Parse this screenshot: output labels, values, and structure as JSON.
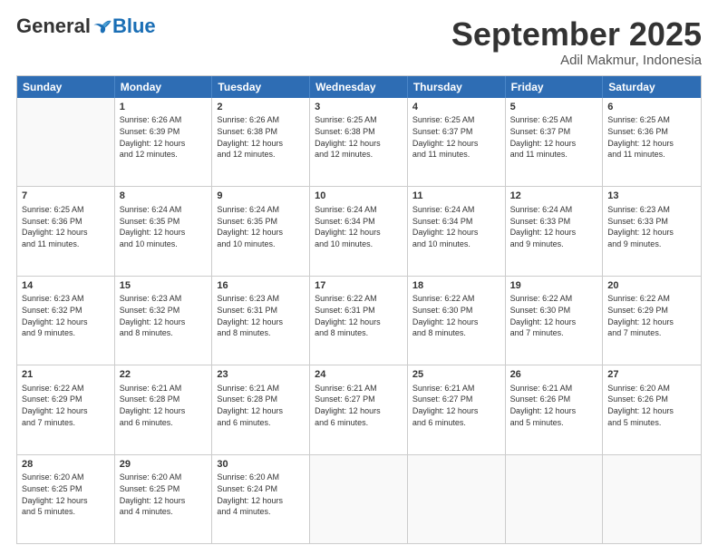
{
  "logo": {
    "general": "General",
    "blue": "Blue"
  },
  "title": "September 2025",
  "location": "Adil Makmur, Indonesia",
  "header_days": [
    "Sunday",
    "Monday",
    "Tuesday",
    "Wednesday",
    "Thursday",
    "Friday",
    "Saturday"
  ],
  "rows": [
    [
      {
        "day": "",
        "info": ""
      },
      {
        "day": "1",
        "info": "Sunrise: 6:26 AM\nSunset: 6:39 PM\nDaylight: 12 hours\nand 12 minutes."
      },
      {
        "day": "2",
        "info": "Sunrise: 6:26 AM\nSunset: 6:38 PM\nDaylight: 12 hours\nand 12 minutes."
      },
      {
        "day": "3",
        "info": "Sunrise: 6:25 AM\nSunset: 6:38 PM\nDaylight: 12 hours\nand 12 minutes."
      },
      {
        "day": "4",
        "info": "Sunrise: 6:25 AM\nSunset: 6:37 PM\nDaylight: 12 hours\nand 11 minutes."
      },
      {
        "day": "5",
        "info": "Sunrise: 6:25 AM\nSunset: 6:37 PM\nDaylight: 12 hours\nand 11 minutes."
      },
      {
        "day": "6",
        "info": "Sunrise: 6:25 AM\nSunset: 6:36 PM\nDaylight: 12 hours\nand 11 minutes."
      }
    ],
    [
      {
        "day": "7",
        "info": "Sunrise: 6:25 AM\nSunset: 6:36 PM\nDaylight: 12 hours\nand 11 minutes."
      },
      {
        "day": "8",
        "info": "Sunrise: 6:24 AM\nSunset: 6:35 PM\nDaylight: 12 hours\nand 10 minutes."
      },
      {
        "day": "9",
        "info": "Sunrise: 6:24 AM\nSunset: 6:35 PM\nDaylight: 12 hours\nand 10 minutes."
      },
      {
        "day": "10",
        "info": "Sunrise: 6:24 AM\nSunset: 6:34 PM\nDaylight: 12 hours\nand 10 minutes."
      },
      {
        "day": "11",
        "info": "Sunrise: 6:24 AM\nSunset: 6:34 PM\nDaylight: 12 hours\nand 10 minutes."
      },
      {
        "day": "12",
        "info": "Sunrise: 6:24 AM\nSunset: 6:33 PM\nDaylight: 12 hours\nand 9 minutes."
      },
      {
        "day": "13",
        "info": "Sunrise: 6:23 AM\nSunset: 6:33 PM\nDaylight: 12 hours\nand 9 minutes."
      }
    ],
    [
      {
        "day": "14",
        "info": "Sunrise: 6:23 AM\nSunset: 6:32 PM\nDaylight: 12 hours\nand 9 minutes."
      },
      {
        "day": "15",
        "info": "Sunrise: 6:23 AM\nSunset: 6:32 PM\nDaylight: 12 hours\nand 8 minutes."
      },
      {
        "day": "16",
        "info": "Sunrise: 6:23 AM\nSunset: 6:31 PM\nDaylight: 12 hours\nand 8 minutes."
      },
      {
        "day": "17",
        "info": "Sunrise: 6:22 AM\nSunset: 6:31 PM\nDaylight: 12 hours\nand 8 minutes."
      },
      {
        "day": "18",
        "info": "Sunrise: 6:22 AM\nSunset: 6:30 PM\nDaylight: 12 hours\nand 8 minutes."
      },
      {
        "day": "19",
        "info": "Sunrise: 6:22 AM\nSunset: 6:30 PM\nDaylight: 12 hours\nand 7 minutes."
      },
      {
        "day": "20",
        "info": "Sunrise: 6:22 AM\nSunset: 6:29 PM\nDaylight: 12 hours\nand 7 minutes."
      }
    ],
    [
      {
        "day": "21",
        "info": "Sunrise: 6:22 AM\nSunset: 6:29 PM\nDaylight: 12 hours\nand 7 minutes."
      },
      {
        "day": "22",
        "info": "Sunrise: 6:21 AM\nSunset: 6:28 PM\nDaylight: 12 hours\nand 6 minutes."
      },
      {
        "day": "23",
        "info": "Sunrise: 6:21 AM\nSunset: 6:28 PM\nDaylight: 12 hours\nand 6 minutes."
      },
      {
        "day": "24",
        "info": "Sunrise: 6:21 AM\nSunset: 6:27 PM\nDaylight: 12 hours\nand 6 minutes."
      },
      {
        "day": "25",
        "info": "Sunrise: 6:21 AM\nSunset: 6:27 PM\nDaylight: 12 hours\nand 6 minutes."
      },
      {
        "day": "26",
        "info": "Sunrise: 6:21 AM\nSunset: 6:26 PM\nDaylight: 12 hours\nand 5 minutes."
      },
      {
        "day": "27",
        "info": "Sunrise: 6:20 AM\nSunset: 6:26 PM\nDaylight: 12 hours\nand 5 minutes."
      }
    ],
    [
      {
        "day": "28",
        "info": "Sunrise: 6:20 AM\nSunset: 6:25 PM\nDaylight: 12 hours\nand 5 minutes."
      },
      {
        "day": "29",
        "info": "Sunrise: 6:20 AM\nSunset: 6:25 PM\nDaylight: 12 hours\nand 4 minutes."
      },
      {
        "day": "30",
        "info": "Sunrise: 6:20 AM\nSunset: 6:24 PM\nDaylight: 12 hours\nand 4 minutes."
      },
      {
        "day": "",
        "info": ""
      },
      {
        "day": "",
        "info": ""
      },
      {
        "day": "",
        "info": ""
      },
      {
        "day": "",
        "info": ""
      }
    ]
  ]
}
